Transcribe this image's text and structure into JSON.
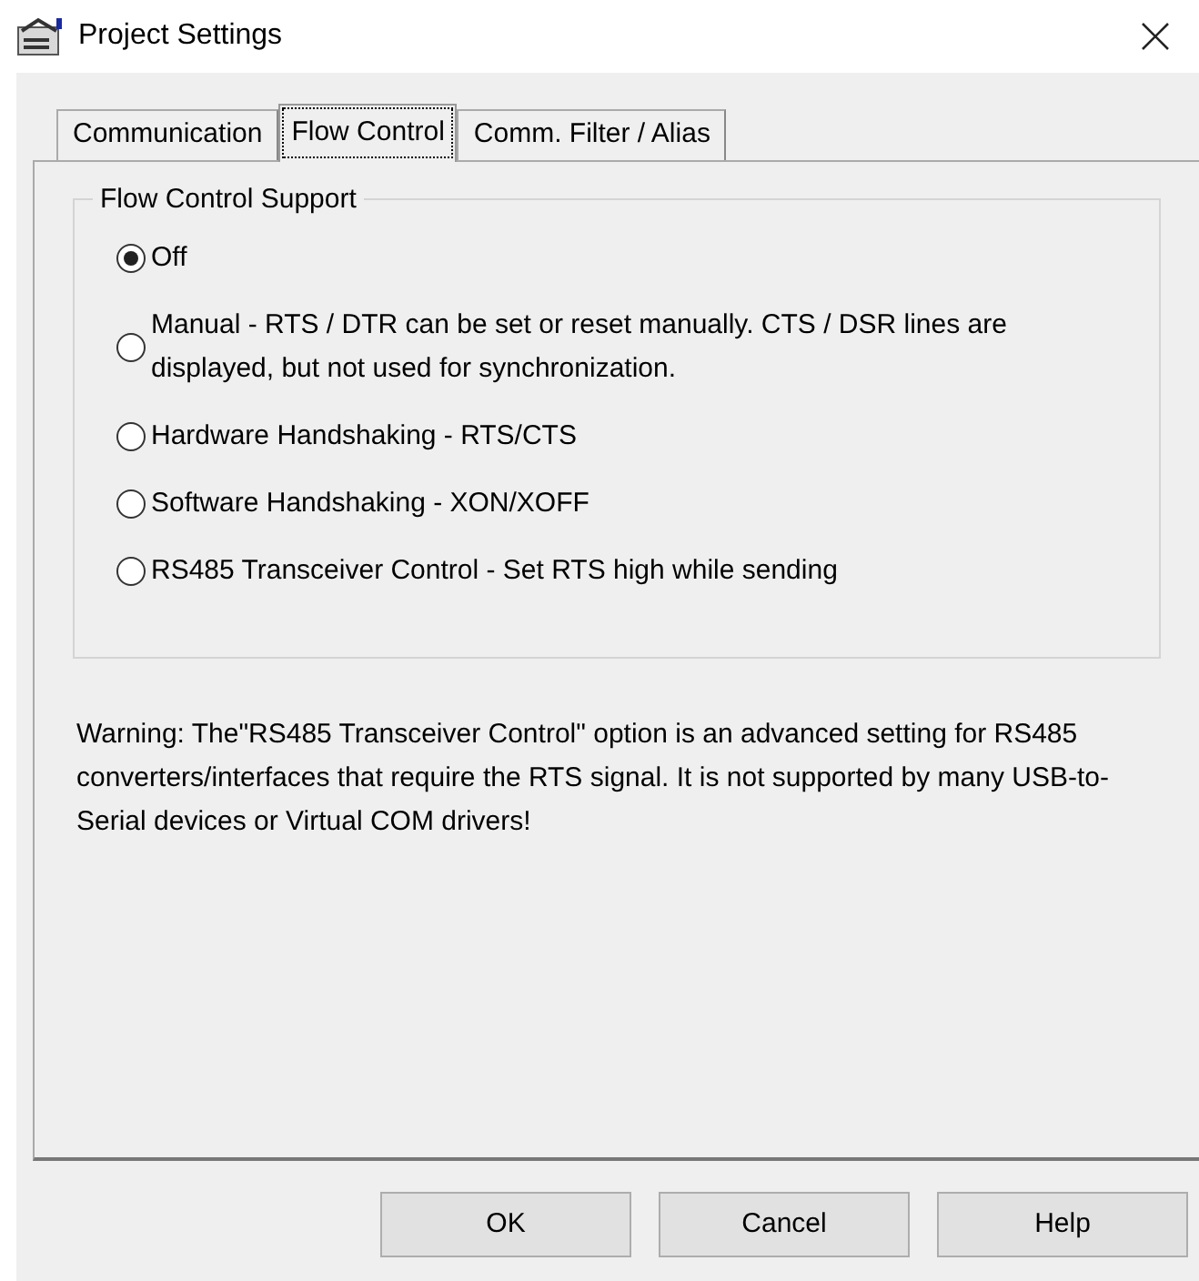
{
  "window": {
    "title": "Project Settings"
  },
  "tabs": [
    {
      "label": "Communication",
      "selected": false
    },
    {
      "label": "Flow Control",
      "selected": true
    },
    {
      "label": "Comm. Filter / Alias",
      "selected": false
    }
  ],
  "group": {
    "title": "Flow Control Support",
    "options": [
      {
        "label": "Off",
        "selected": true
      },
      {
        "label": "Manual  -  RTS / DTR can be set or reset manually. CTS / DSR lines are displayed, but not used for synchronization.",
        "selected": false
      },
      {
        "label": "Hardware Handshaking - RTS/CTS",
        "selected": false
      },
      {
        "label": "Software Handshaking -  XON/XOFF",
        "selected": false
      },
      {
        "label": "RS485 Transceiver Control - Set RTS high while sending",
        "selected": false
      }
    ]
  },
  "warning": "Warning: The\"RS485 Transceiver Control\" option is an advanced setting for RS485 converters/interfaces that require the RTS signal. It is not supported by many USB-to-Serial devices or Virtual COM drivers!",
  "buttons": [
    "OK",
    "Cancel",
    "Help"
  ]
}
